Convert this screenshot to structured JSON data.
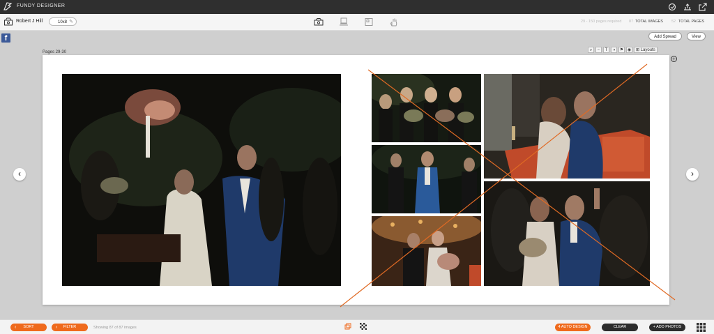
{
  "app": {
    "title": "FUNDY DESIGNER"
  },
  "toolbar": {
    "client_name": "Robert J Hill",
    "album_name": "10x8",
    "stats": {
      "pages_required": "29 - 150 pages required",
      "total_images_count": "87",
      "total_images_label": "TOTAL IMAGES",
      "total_pages_count": "52",
      "total_pages_label": "TOTAL PAGES"
    }
  },
  "actions": {
    "add_spread": "Add Spread",
    "view": "View"
  },
  "spread": {
    "pages_label": "Pages 29-30"
  },
  "tools": {
    "layouts_label": "Layouts"
  },
  "bottom": {
    "sort": "SORT",
    "filter": "FILTER",
    "showing": "Showing 87 of 87 images",
    "auto_design": "4 AUTO DESIGN",
    "clear": "CLEAR",
    "add_photos": "+ ADD PHOTOS"
  },
  "colors": {
    "accent": "#ef6a1c",
    "dark": "#2f2f2f",
    "facebook": "#3b5998"
  },
  "icons": {
    "topbar": [
      "fundy-logo-icon",
      "spellcheck-icon",
      "share-icon",
      "external-link-icon"
    ],
    "center": [
      "album-icon",
      "proof-icon",
      "layout-icon",
      "hand-icon"
    ]
  }
}
